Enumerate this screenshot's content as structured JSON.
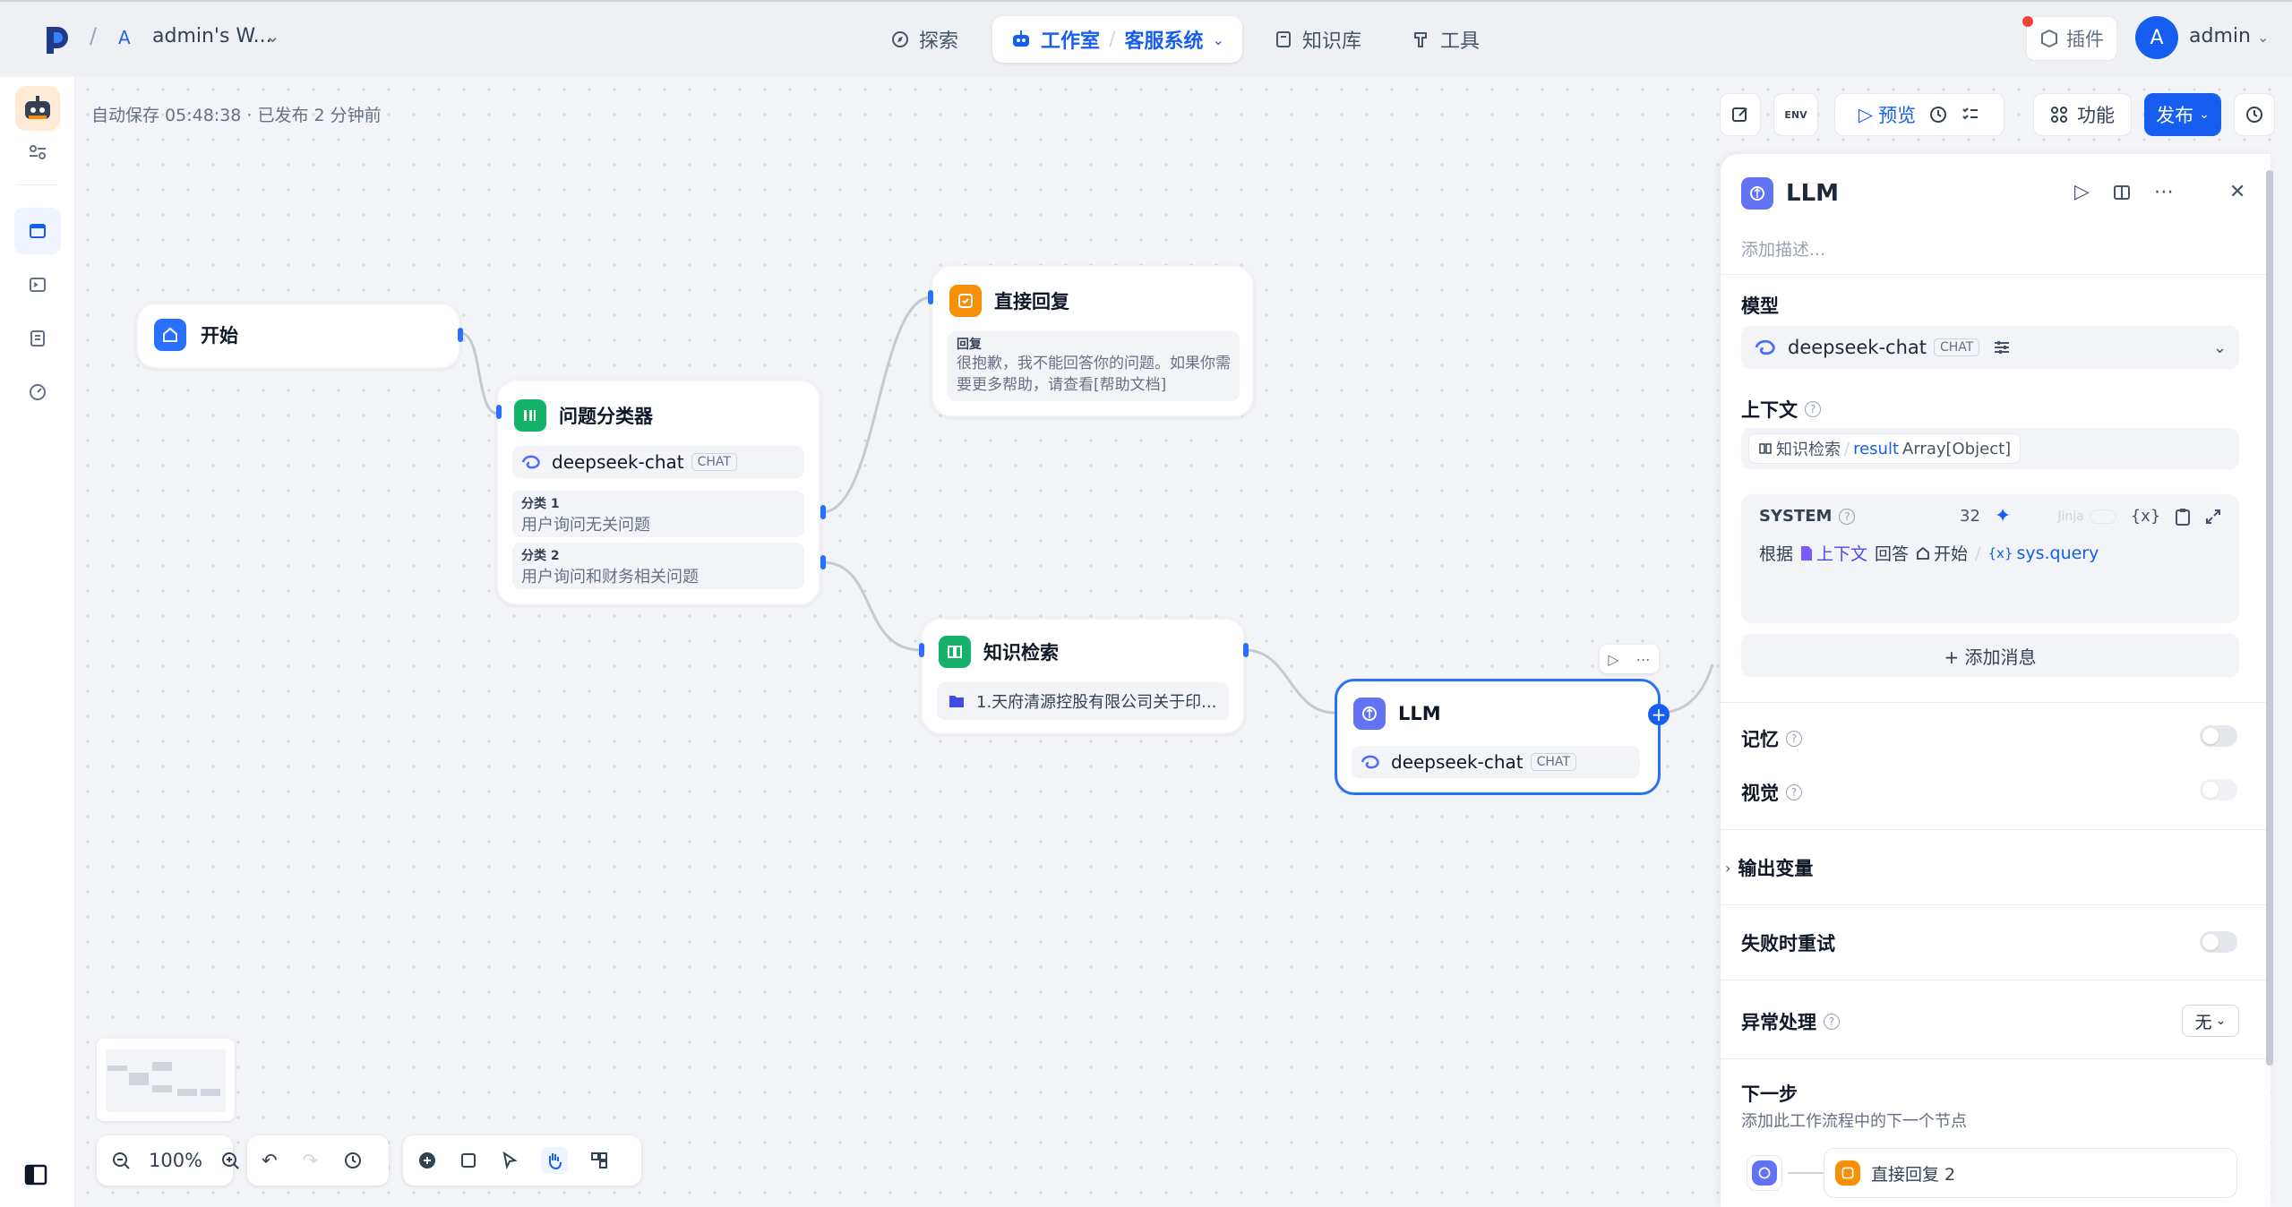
{
  "workspace": {
    "badge": "A",
    "name": "admin's W...",
    "separator": "/"
  },
  "nav": {
    "explore": "探索",
    "studio": "工作室",
    "app_name": "客服系统",
    "knowledge": "知识库",
    "tools": "工具"
  },
  "header_right": {
    "plugins": "插件",
    "avatar_letter": "A",
    "user": "admin"
  },
  "canvas": {
    "autosave": "自动保存 05:48:38 · 已发布 2 分钟前"
  },
  "toolbar": {
    "preview": "预览",
    "features": "功能",
    "publish": "发布",
    "env_label": "ENV"
  },
  "nodes": {
    "start": {
      "title": "开始"
    },
    "classifier": {
      "title": "问题分类器",
      "model": "deepseek-chat",
      "model_tag": "CHAT",
      "classes": [
        {
          "label": "分类 1",
          "text": "用户询问无关问题"
        },
        {
          "label": "分类 2",
          "text": "用户询问和财务相关问题"
        }
      ]
    },
    "answer": {
      "title": "直接回复",
      "label": "回复",
      "text": "很抱歉，我不能回答你的问题。如果你需要更多帮助，请查看[帮助文档]"
    },
    "retrieval": {
      "title": "知识检索",
      "doc": "1.天府清源控股有限公司关于印..."
    },
    "llm": {
      "title": "LLM",
      "model": "deepseek-chat",
      "model_tag": "CHAT"
    }
  },
  "panel": {
    "title": "LLM",
    "description_placeholder": "添加描述...",
    "model_label": "模型",
    "model": "deepseek-chat",
    "model_tag": "CHAT",
    "context_label": "上下文",
    "context_source": "知识检索",
    "context_sep": "/",
    "context_var": "result",
    "context_type": "Array[Object]",
    "system_label": "SYSTEM",
    "token_count": "32",
    "jinja": "Jinja",
    "var_icon": "{x}",
    "prompt": {
      "p1": "根据",
      "ctx": "上下文",
      "p2": "回答",
      "node": "开始",
      "sep": "/",
      "var_prefix": "{x}",
      "var": "sys.query"
    },
    "add_message": "+ 添加消息",
    "memory": "记忆",
    "vision": "视觉",
    "output_vars": "输出变量",
    "retry": "失败时重试",
    "error_handling": "异常处理",
    "error_value": "无",
    "next_step": "下一步",
    "next_step_desc": "添加此工作流程中的下一个节点",
    "next_node": "直接回复 2"
  },
  "zoom": {
    "level": "100%"
  },
  "colors": {
    "primary": "#155eef",
    "start": "#2970ff",
    "classifier": "#17b26a",
    "answer": "#f79009",
    "retrieval": "#17b26a",
    "llm": "#6172f3"
  }
}
